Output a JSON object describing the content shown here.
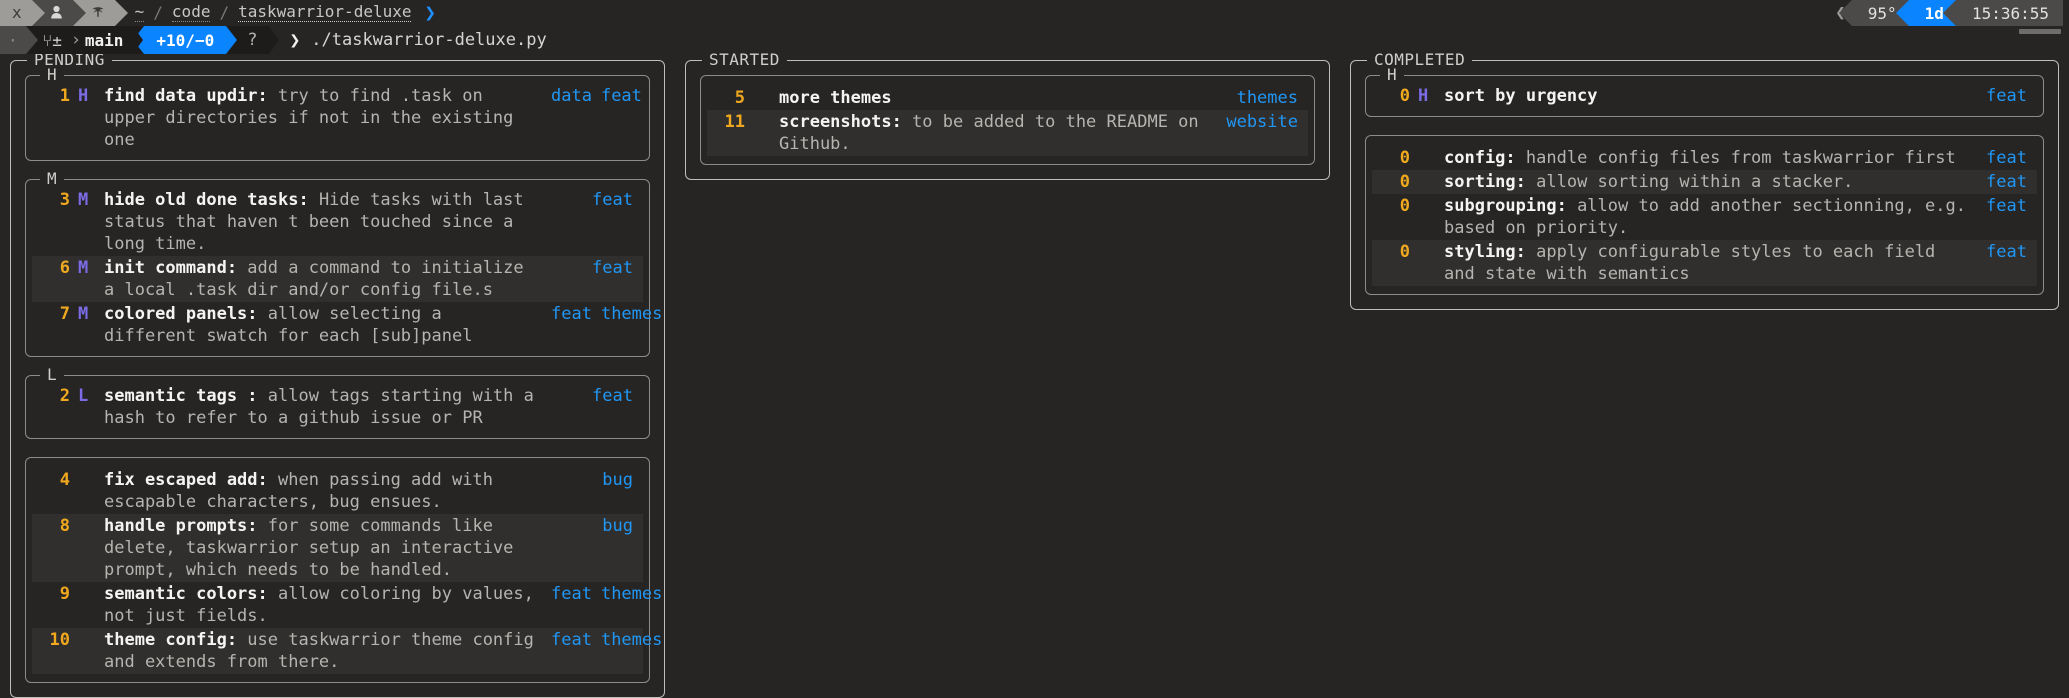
{
  "topbar": {
    "segments": [
      {
        "name": "user-xterm-segment",
        "icon": "x-logo-icon",
        "label": "X"
      },
      {
        "name": "user-segment",
        "icon": "person-icon",
        "label": "♟"
      },
      {
        "name": "session-segment",
        "icon": "palm-tree-icon",
        "label": "⚘"
      }
    ],
    "path": {
      "home": "~",
      "sep": "/",
      "parts": [
        "code",
        "taskwarrior-deluxe"
      ]
    },
    "right": {
      "temperature": "95°",
      "duration": "1d",
      "clock": "15:36:55"
    }
  },
  "promptbar": {
    "dot": "·",
    "branch_icon": "⑂±",
    "branch": "main",
    "diff": "+10/−0",
    "question": "?",
    "prompt_symbol": "❯",
    "command": "./taskwarrior-deluxe.py"
  },
  "panels": [
    {
      "name": "pending",
      "title": "PENDING",
      "groups": [
        {
          "label": "H",
          "tasks": [
            {
              "id": "1",
              "priority": "H",
              "title": "find data updir:",
              "desc": "try to find .task on upper directories if not in the existing one",
              "tags": [
                "data",
                "feat"
              ],
              "alt": false
            }
          ]
        },
        {
          "label": "M",
          "tasks": [
            {
              "id": "3",
              "priority": "M",
              "title": "hide old done tasks:",
              "desc": "Hide tasks with last status that haven t been touched since a long time.",
              "tags": [
                "feat"
              ],
              "alt": false
            },
            {
              "id": "6",
              "priority": "M",
              "title": "init command:",
              "desc": "add a command to initialize a local .task dir and/or config file.s",
              "tags": [
                "feat"
              ],
              "alt": true
            },
            {
              "id": "7",
              "priority": "M",
              "title": "colored panels:",
              "desc": "allow selecting a different swatch for each [sub]panel",
              "tags": [
                "feat",
                "themes"
              ],
              "alt": false
            }
          ]
        },
        {
          "label": "L",
          "tasks": [
            {
              "id": "2",
              "priority": "L",
              "title": "semantic tags :",
              "desc": "allow tags starting with a hash to refer to a github issue or PR",
              "tags": [
                "feat"
              ],
              "alt": false
            }
          ]
        },
        {
          "label": "",
          "tasks": [
            {
              "id": "4",
              "priority": "",
              "title": "fix escaped add:",
              "desc": "when passing add with escapable characters, bug ensues.",
              "tags": [
                "bug"
              ],
              "alt": false
            },
            {
              "id": "8",
              "priority": "",
              "title": "handle prompts:",
              "desc": "for some commands like delete, taskwarrior setup an interactive prompt, which needs to be handled.",
              "tags": [
                "bug"
              ],
              "alt": true
            },
            {
              "id": "9",
              "priority": "",
              "title": "semantic colors:",
              "desc": "allow coloring by values, not just fields.",
              "tags": [
                "feat",
                "themes"
              ],
              "alt": false
            },
            {
              "id": "10",
              "priority": "",
              "title": "theme config:",
              "desc": "use taskwarrior theme config and extends from there.",
              "tags": [
                "feat",
                "themes"
              ],
              "alt": true
            }
          ]
        }
      ]
    },
    {
      "name": "started",
      "title": "STARTED",
      "groups": [
        {
          "label": "",
          "tasks": [
            {
              "id": "5",
              "priority": "",
              "title": "more themes",
              "desc": "",
              "tags": [
                "themes"
              ],
              "alt": false
            },
            {
              "id": "11",
              "priority": "",
              "title": "screenshots:",
              "desc": "to be added to the README on Github.",
              "tags": [
                "website"
              ],
              "alt": true
            }
          ]
        }
      ]
    },
    {
      "name": "completed",
      "title": "COMPLETED",
      "groups": [
        {
          "label": "H",
          "tasks": [
            {
              "id": "0",
              "priority": "H",
              "title": "sort by urgency",
              "desc": "",
              "tags": [
                "feat"
              ],
              "alt": false
            }
          ]
        },
        {
          "label": "",
          "tasks": [
            {
              "id": "0",
              "priority": "",
              "title": "config:",
              "desc": "handle config files from taskwarrior first",
              "tags": [
                "feat"
              ],
              "alt": false
            },
            {
              "id": "0",
              "priority": "",
              "title": "sorting:",
              "desc": "allow sorting within a stacker.",
              "tags": [
                "feat"
              ],
              "alt": true
            },
            {
              "id": "0",
              "priority": "",
              "title": "subgrouping:",
              "desc": "allow to add another sectionning, e.g. based on priority.",
              "tags": [
                "feat"
              ],
              "alt": false
            },
            {
              "id": "0",
              "priority": "",
              "title": "styling:",
              "desc": "apply configurable styles to each field and state with semantics",
              "tags": [
                "feat"
              ],
              "alt": true
            }
          ]
        }
      ]
    }
  ],
  "colors": {
    "background": "#262524",
    "accent_blue": "#0a84ff",
    "tag_blue": "#2196f3",
    "id_orange": "#f0a91e",
    "priority_purple": "#7b6ce6",
    "panel_border": "#bfbeba",
    "group_border": "#8d8c8a",
    "row_alt": "#302f2d"
  }
}
